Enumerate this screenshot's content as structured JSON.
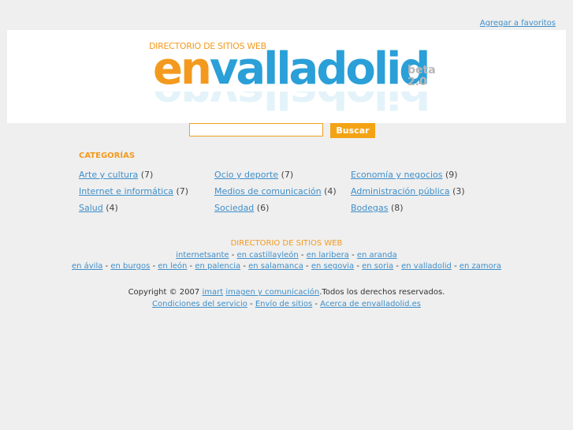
{
  "top": {
    "favorites_link": "Agregar a favoritos"
  },
  "logo": {
    "subtitle": "DIRECTORIO DE SITIOS WEB",
    "brand_en": "en",
    "brand_city": "valladolid",
    "beta_line1": "beta",
    "beta_line2": "2.0"
  },
  "search": {
    "input_value": "",
    "button_label": "Buscar"
  },
  "categories": {
    "title": "CATEGORÍAS",
    "items": [
      {
        "label": "Arte y cultura",
        "count": "(7)"
      },
      {
        "label": "Ocio y deporte",
        "count": "(7)"
      },
      {
        "label": "Economía y negocios",
        "count": "(9)"
      },
      {
        "label": "Internet e informática",
        "count": "(7)"
      },
      {
        "label": "Medios de comunicación",
        "count": "(4)"
      },
      {
        "label": "Administración pública",
        "count": "(3)"
      },
      {
        "label": "Salud",
        "count": "(4)"
      },
      {
        "label": "Sociedad",
        "count": "(6)"
      },
      {
        "label": "Bodegas",
        "count": "(8)"
      }
    ]
  },
  "network": {
    "title": "DIRECTORIO DE SITIOS WEB",
    "row1": [
      "internetsante",
      "en castillayleón",
      "en laribera",
      "en aranda"
    ],
    "row2": [
      "en ávila",
      "en burgos",
      "en león",
      "en palencia",
      "en salamanca",
      "en segovia",
      "en soria",
      "en valladolid",
      "en zamora"
    ],
    "separator": " - "
  },
  "copyright": {
    "prefix": "Copyright © 2007 ",
    "link1": "imart",
    "link2": "imagen y comunicación",
    "suffix": ".Todos los derechos reservados."
  },
  "legal": {
    "links": [
      "Condiciones del servicio",
      "Envío de sitios",
      "Acerca de envalladolid.es"
    ],
    "separator": " - "
  }
}
